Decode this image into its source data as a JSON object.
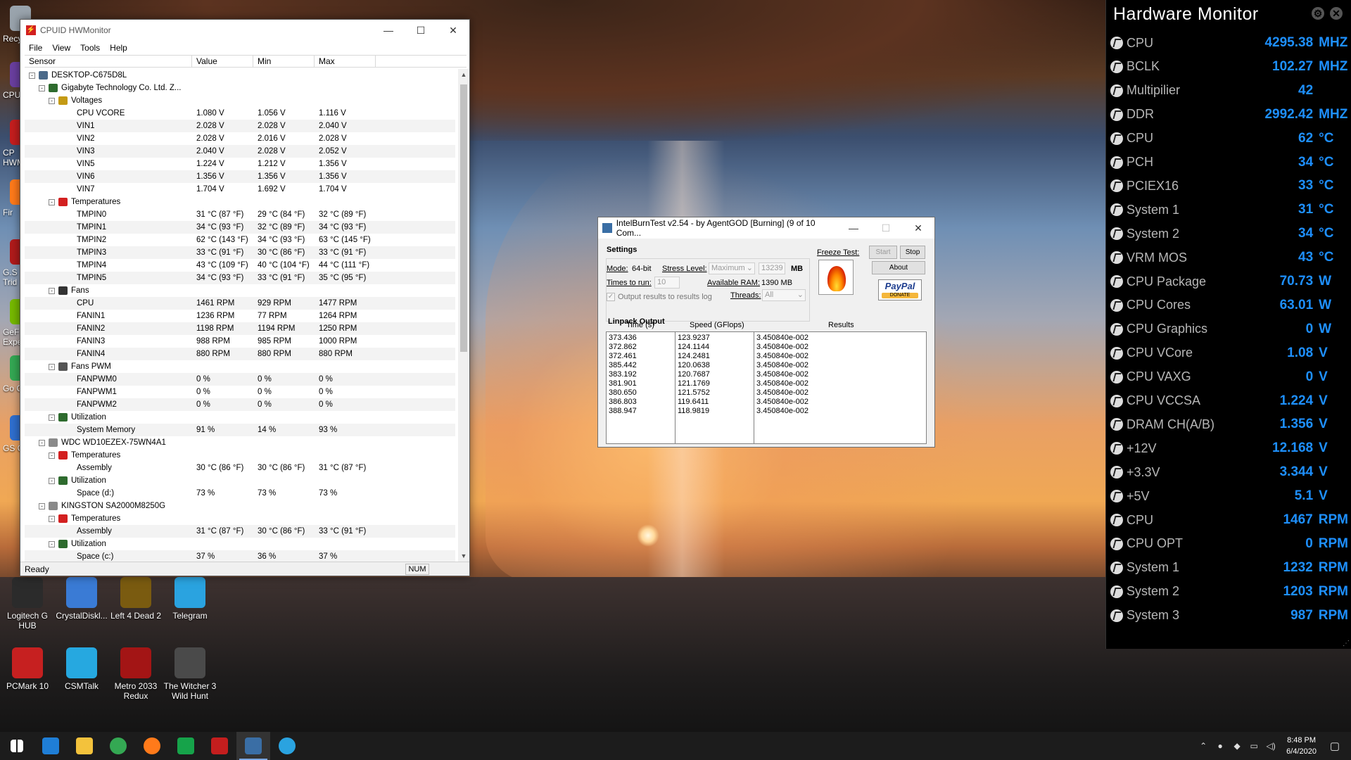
{
  "desktop": {
    "icons": [
      {
        "label": "Recy",
        "color": "#9aa4ad"
      },
      {
        "label": "CPUI",
        "color": "#6a3fa0"
      },
      {
        "label": "CP HWM",
        "color": "#c41e1e"
      },
      {
        "label": "Fir",
        "color": "#ff7a1a"
      },
      {
        "label": "G.S Trid",
        "color": "#b01b1b"
      },
      {
        "label": "GeF Expe",
        "color": "#76b900"
      },
      {
        "label": "Go Chr",
        "color": "#34a853"
      },
      {
        "label": "GS Cli",
        "color": "#2f6fcf"
      }
    ],
    "bottom_icons": [
      {
        "label": "Logitech G HUB",
        "color": "#2b2b2b"
      },
      {
        "label": "CrystalDiskl...",
        "color": "#3a7bd5"
      },
      {
        "label": "Left 4 Dead 2",
        "color": "#7a5b10"
      },
      {
        "label": "Telegram",
        "color": "#2aa3e0"
      },
      {
        "label": "PCMark 10",
        "color": "#c62020"
      },
      {
        "label": "CSMTalk",
        "color": "#26a8e0"
      },
      {
        "label": "Metro 2033 Redux",
        "color": "#a31515"
      },
      {
        "label": "The Witcher 3 Wild Hunt",
        "color": "#4a4a4a"
      }
    ]
  },
  "hwmonitor": {
    "title": "CPUID HWMonitor",
    "menu": [
      "File",
      "View",
      "Tools",
      "Help"
    ],
    "columns": [
      "Sensor",
      "Value",
      "Min",
      "Max"
    ],
    "rows": [
      {
        "level": 0,
        "toggle": "-",
        "icon": "computer",
        "name": "DESKTOP-C675D8L",
        "value": "",
        "min": "",
        "max": ""
      },
      {
        "level": 1,
        "toggle": "-",
        "icon": "board",
        "name": "Gigabyte Technology Co. Ltd. Z...",
        "value": "",
        "min": "",
        "max": ""
      },
      {
        "level": 2,
        "toggle": "-",
        "icon": "volt",
        "name": "Voltages",
        "value": "",
        "min": "",
        "max": ""
      },
      {
        "level": 3,
        "toggle": "",
        "icon": "",
        "name": "CPU VCORE",
        "value": "1.080 V",
        "min": "1.056 V",
        "max": "1.116 V"
      },
      {
        "level": 3,
        "toggle": "",
        "icon": "",
        "name": "VIN1",
        "value": "2.028 V",
        "min": "2.028 V",
        "max": "2.040 V"
      },
      {
        "level": 3,
        "toggle": "",
        "icon": "",
        "name": "VIN2",
        "value": "2.028 V",
        "min": "2.016 V",
        "max": "2.028 V"
      },
      {
        "level": 3,
        "toggle": "",
        "icon": "",
        "name": "VIN3",
        "value": "2.040 V",
        "min": "2.028 V",
        "max": "2.052 V"
      },
      {
        "level": 3,
        "toggle": "",
        "icon": "",
        "name": "VIN5",
        "value": "1.224 V",
        "min": "1.212 V",
        "max": "1.356 V"
      },
      {
        "level": 3,
        "toggle": "",
        "icon": "",
        "name": "VIN6",
        "value": "1.356 V",
        "min": "1.356 V",
        "max": "1.356 V"
      },
      {
        "level": 3,
        "toggle": "",
        "icon": "",
        "name": "VIN7",
        "value": "1.704 V",
        "min": "1.692 V",
        "max": "1.704 V"
      },
      {
        "level": 2,
        "toggle": "-",
        "icon": "temp",
        "name": "Temperatures",
        "value": "",
        "min": "",
        "max": ""
      },
      {
        "level": 3,
        "toggle": "",
        "icon": "",
        "name": "TMPIN0",
        "value": "31 °C  (87 °F)",
        "min": "29 °C  (84 °F)",
        "max": "32 °C  (89 °F)"
      },
      {
        "level": 3,
        "toggle": "",
        "icon": "",
        "name": "TMPIN1",
        "value": "34 °C  (93 °F)",
        "min": "32 °C  (89 °F)",
        "max": "34 °C  (93 °F)"
      },
      {
        "level": 3,
        "toggle": "",
        "icon": "",
        "name": "TMPIN2",
        "value": "62 °C  (143 °F)",
        "min": "34 °C  (93 °F)",
        "max": "63 °C  (145 °F)"
      },
      {
        "level": 3,
        "toggle": "",
        "icon": "",
        "name": "TMPIN3",
        "value": "33 °C  (91 °F)",
        "min": "30 °C  (86 °F)",
        "max": "33 °C  (91 °F)"
      },
      {
        "level": 3,
        "toggle": "",
        "icon": "",
        "name": "TMPIN4",
        "value": "43 °C  (109 °F)",
        "min": "40 °C  (104 °F)",
        "max": "44 °C  (111 °F)"
      },
      {
        "level": 3,
        "toggle": "",
        "icon": "",
        "name": "TMPIN5",
        "value": "34 °C  (93 °F)",
        "min": "33 °C  (91 °F)",
        "max": "35 °C  (95 °F)"
      },
      {
        "level": 2,
        "toggle": "-",
        "icon": "fan",
        "name": "Fans",
        "value": "",
        "min": "",
        "max": ""
      },
      {
        "level": 3,
        "toggle": "",
        "icon": "",
        "name": "CPU",
        "value": "1461 RPM",
        "min": "929 RPM",
        "max": "1477 RPM"
      },
      {
        "level": 3,
        "toggle": "",
        "icon": "",
        "name": "FANIN1",
        "value": "1236 RPM",
        "min": "77 RPM",
        "max": "1264 RPM"
      },
      {
        "level": 3,
        "toggle": "",
        "icon": "",
        "name": "FANIN2",
        "value": "1198 RPM",
        "min": "1194 RPM",
        "max": "1250 RPM"
      },
      {
        "level": 3,
        "toggle": "",
        "icon": "",
        "name": "FANIN3",
        "value": "988 RPM",
        "min": "985 RPM",
        "max": "1000 RPM"
      },
      {
        "level": 3,
        "toggle": "",
        "icon": "",
        "name": "FANIN4",
        "value": "880 RPM",
        "min": "880 RPM",
        "max": "880 RPM"
      },
      {
        "level": 2,
        "toggle": "-",
        "icon": "fanpwm",
        "name": "Fans PWM",
        "value": "",
        "min": "",
        "max": ""
      },
      {
        "level": 3,
        "toggle": "",
        "icon": "",
        "name": "FANPWM0",
        "value": "0 %",
        "min": "0 %",
        "max": "0 %"
      },
      {
        "level": 3,
        "toggle": "",
        "icon": "",
        "name": "FANPWM1",
        "value": "0 %",
        "min": "0 %",
        "max": "0 %"
      },
      {
        "level": 3,
        "toggle": "",
        "icon": "",
        "name": "FANPWM2",
        "value": "0 %",
        "min": "0 %",
        "max": "0 %"
      },
      {
        "level": 2,
        "toggle": "-",
        "icon": "util",
        "name": "Utilization",
        "value": "",
        "min": "",
        "max": ""
      },
      {
        "level": 3,
        "toggle": "",
        "icon": "",
        "name": "System Memory",
        "value": "91 %",
        "min": "14 %",
        "max": "93 %"
      },
      {
        "level": 1,
        "toggle": "-",
        "icon": "disk",
        "name": "WDC WD10EZEX-75WN4A1",
        "value": "",
        "min": "",
        "max": ""
      },
      {
        "level": 2,
        "toggle": "-",
        "icon": "temp",
        "name": "Temperatures",
        "value": "",
        "min": "",
        "max": ""
      },
      {
        "level": 3,
        "toggle": "",
        "icon": "",
        "name": "Assembly",
        "value": "30 °C  (86 °F)",
        "min": "30 °C  (86 °F)",
        "max": "31 °C  (87 °F)"
      },
      {
        "level": 2,
        "toggle": "-",
        "icon": "util",
        "name": "Utilization",
        "value": "",
        "min": "",
        "max": ""
      },
      {
        "level": 3,
        "toggle": "",
        "icon": "",
        "name": "Space (d:)",
        "value": "73 %",
        "min": "73 %",
        "max": "73 %"
      },
      {
        "level": 1,
        "toggle": "-",
        "icon": "disk",
        "name": "KINGSTON SA2000M8250G",
        "value": "",
        "min": "",
        "max": ""
      },
      {
        "level": 2,
        "toggle": "-",
        "icon": "temp",
        "name": "Temperatures",
        "value": "",
        "min": "",
        "max": ""
      },
      {
        "level": 3,
        "toggle": "",
        "icon": "",
        "name": "Assembly",
        "value": "31 °C  (87 °F)",
        "min": "30 °C  (86 °F)",
        "max": "33 °C  (91 °F)"
      },
      {
        "level": 2,
        "toggle": "-",
        "icon": "util",
        "name": "Utilization",
        "value": "",
        "min": "",
        "max": ""
      },
      {
        "level": 3,
        "toggle": "",
        "icon": "",
        "name": "Space (c:)",
        "value": "37 %",
        "min": "36 %",
        "max": "37 %"
      }
    ],
    "status": "Ready",
    "num_indicator": "NUM"
  },
  "ibt": {
    "title": "IntelBurnTest v2.54 - by AgentGOD [Burning] (9 of 10 Com...",
    "settings_label": "Settings",
    "mode_label": "Mode:",
    "mode_value": "64-bit",
    "stress_label": "Stress Level:",
    "stress_value": "Maximum",
    "mb_value": "13239",
    "mb_unit": "MB",
    "times_label": "Times to run:",
    "times_value": "10",
    "ram_label": "Available RAM:",
    "ram_value": "1390 MB",
    "threads_label": "Threads:",
    "threads_value": "All",
    "log_label": "Output results to results log",
    "freeze_label": "Freeze Test:",
    "start": "Start",
    "stop": "Stop",
    "about": "About",
    "paypal": "PayPal",
    "donate": "DONATE",
    "linpack_label": "Linpack Output",
    "col_time": "Time (s)",
    "col_speed": "Speed (GFlops)",
    "col_results": "Results",
    "times": [
      "373.436",
      "372.862",
      "372.461",
      "385.442",
      "383.192",
      "381.901",
      "380.650",
      "386.803",
      "388.947"
    ],
    "speeds": [
      "123.9237",
      "124.1144",
      "124.2481",
      "120.0638",
      "120.7687",
      "121.1769",
      "121.5752",
      "119.6411",
      "118.9819"
    ],
    "results": [
      "3.450840e-002",
      "3.450840e-002",
      "3.450840e-002",
      "3.450840e-002",
      "3.450840e-002",
      "3.450840e-002",
      "3.450840e-002",
      "3.450840e-002",
      "3.450840e-002"
    ]
  },
  "gadget": {
    "title": "Hardware Monitor",
    "rows": [
      {
        "icon": "clock-icon",
        "label": "CPU",
        "value": "4295.38",
        "unit": "MHZ"
      },
      {
        "icon": "clock-icon",
        "label": "BCLK",
        "value": "102.27",
        "unit": "MHZ"
      },
      {
        "icon": "clock-icon",
        "label": "Multipilier",
        "value": "42",
        "unit": ""
      },
      {
        "icon": "clock-icon",
        "label": "DDR",
        "value": "2992.42",
        "unit": "MHZ"
      },
      {
        "icon": "thermometer-icon",
        "label": "CPU",
        "value": "62",
        "unit": "°C"
      },
      {
        "icon": "thermometer-icon",
        "label": "PCH",
        "value": "34",
        "unit": "°C"
      },
      {
        "icon": "thermometer-icon",
        "label": "PCIEX16",
        "value": "33",
        "unit": "°C"
      },
      {
        "icon": "thermometer-icon",
        "label": "System 1",
        "value": "31",
        "unit": "°C"
      },
      {
        "icon": "thermometer-icon",
        "label": "System 2",
        "value": "34",
        "unit": "°C"
      },
      {
        "icon": "thermometer-icon",
        "label": "VRM MOS",
        "value": "43",
        "unit": "°C"
      },
      {
        "icon": "power-icon",
        "label": "CPU Package",
        "value": "70.73",
        "unit": "W"
      },
      {
        "icon": "power-icon",
        "label": "CPU Cores",
        "value": "63.01",
        "unit": "W"
      },
      {
        "icon": "power-icon",
        "label": "CPU Graphics",
        "value": "0",
        "unit": "W"
      },
      {
        "icon": "voltage-icon",
        "label": "CPU VCore",
        "value": "1.08",
        "unit": "V"
      },
      {
        "icon": "voltage-icon",
        "label": "CPU VAXG",
        "value": "0",
        "unit": "V"
      },
      {
        "icon": "voltage-icon",
        "label": "CPU VCCSA",
        "value": "1.224",
        "unit": "V"
      },
      {
        "icon": "voltage-icon",
        "label": "DRAM CH(A/B)",
        "value": "1.356",
        "unit": "V"
      },
      {
        "icon": "voltage-icon",
        "label": "+12V",
        "value": "12.168",
        "unit": "V"
      },
      {
        "icon": "voltage-icon",
        "label": "+3.3V",
        "value": "3.344",
        "unit": "V"
      },
      {
        "icon": "voltage-icon",
        "label": "+5V",
        "value": "5.1",
        "unit": "V"
      },
      {
        "icon": "fan-icon",
        "label": "CPU",
        "value": "1467",
        "unit": "RPM"
      },
      {
        "icon": "fan-icon",
        "label": "CPU OPT",
        "value": "0",
        "unit": "RPM"
      },
      {
        "icon": "fan-icon",
        "label": "System 1",
        "value": "1232",
        "unit": "RPM"
      },
      {
        "icon": "fan-icon",
        "label": "System 2",
        "value": "1203",
        "unit": "RPM"
      },
      {
        "icon": "fan-icon",
        "label": "System 3",
        "value": "987",
        "unit": "RPM"
      }
    ]
  },
  "taskbar": {
    "apps": [
      {
        "name": "start-button",
        "color": "#ffffff"
      },
      {
        "name": "edge",
        "color": "#1f7ed6"
      },
      {
        "name": "file-explorer",
        "color": "#f3c23c"
      },
      {
        "name": "chrome",
        "color": "#34a853"
      },
      {
        "name": "firefox",
        "color": "#ff7a1a"
      },
      {
        "name": "geforce",
        "color": "#16a34a"
      },
      {
        "name": "hwmonitor",
        "color": "#c41e1e"
      },
      {
        "name": "intelburntest",
        "color": "#3a6ea5"
      },
      {
        "name": "telegram",
        "color": "#2aa3e0"
      }
    ],
    "time": "8:48 PM",
    "date": "6/4/2020"
  },
  "colors": {
    "gadget_value": "#1e90ff",
    "accent": "#0078d7"
  }
}
